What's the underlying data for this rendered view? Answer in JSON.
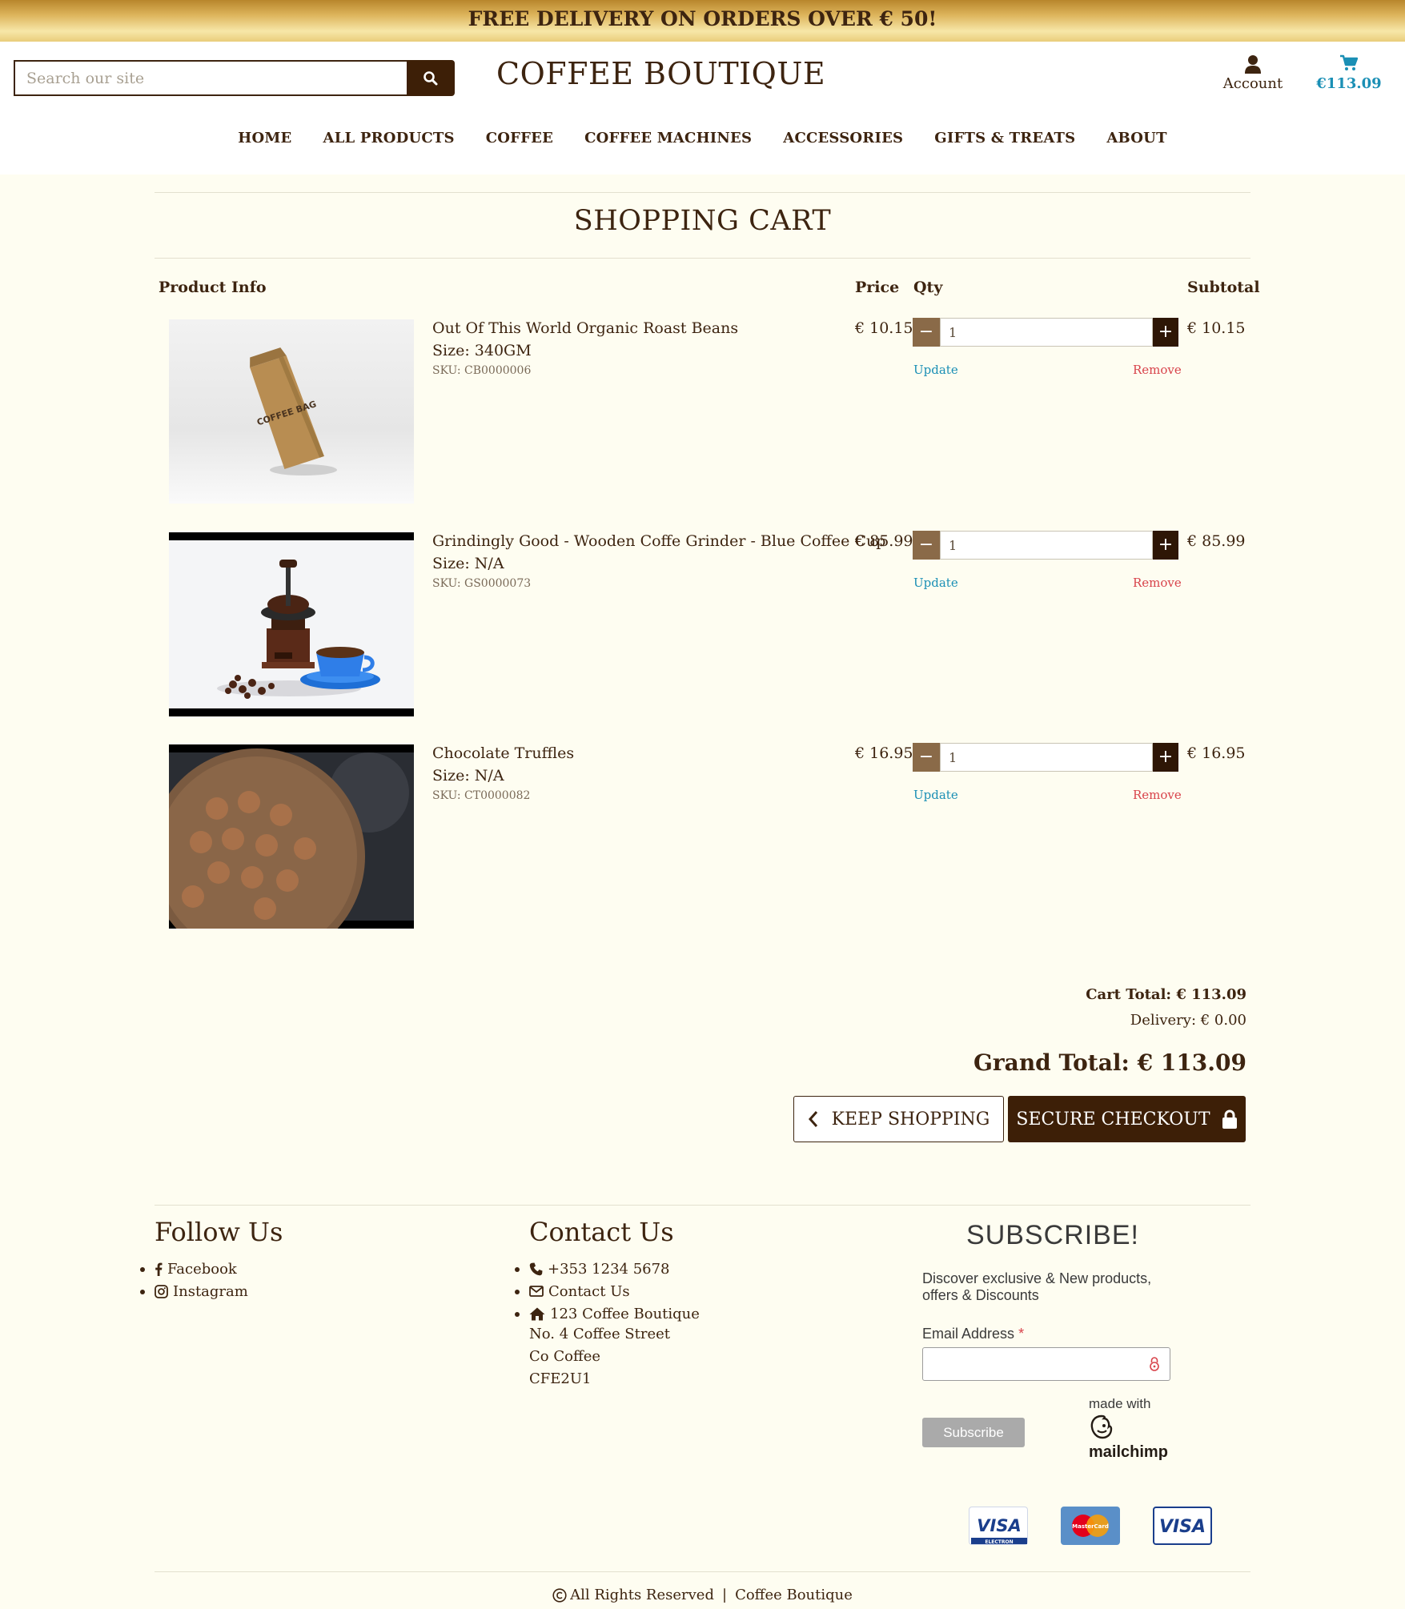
{
  "banner": {
    "text": "FREE DELIVERY ON ORDERS OVER € 50!"
  },
  "header": {
    "search_placeholder": "Search our site",
    "site_title": "COFFEE BOUTIQUE",
    "account_label": "Account",
    "cart_total": "€113.09"
  },
  "nav": [
    "HOME",
    "ALL PRODUCTS",
    "COFFEE",
    "COFFEE MACHINES",
    "ACCESSORIES",
    "GIFTS & TREATS",
    "ABOUT"
  ],
  "page_title": "SHOPPING CART",
  "columns": {
    "product": "Product Info",
    "price": "Price",
    "qty": "Qty",
    "subtotal": "Subtotal"
  },
  "items": [
    {
      "name": "Out Of This World Organic Roast Beans",
      "size": "Size: 340GM",
      "sku": "SKU: CB0000006",
      "price": "€ 10.15",
      "qty": "1",
      "subtotal": "€ 10.15",
      "update": "Update",
      "remove": "Remove",
      "image_label": "COFFEE BAG"
    },
    {
      "name": "Grindingly Good - Wooden Coffe Grinder - Blue Coffee Cup",
      "size": "Size: N/A",
      "sku": "SKU: GS0000073",
      "price": "€ 85.99",
      "qty": "1",
      "subtotal": "€ 85.99",
      "update": "Update",
      "remove": "Remove"
    },
    {
      "name": "Chocolate Truffles",
      "size": "Size: N/A",
      "sku": "SKU: CT0000082",
      "price": "€ 16.95",
      "qty": "1",
      "subtotal": "€ 16.95",
      "update": "Update",
      "remove": "Remove"
    }
  ],
  "totals": {
    "cart_total": "Cart Total: € 113.09",
    "delivery": "Delivery: € 0.00",
    "grand_total": "Grand Total: € 113.09"
  },
  "buttons": {
    "keep_shopping": "KEEP SHOPPING",
    "secure_checkout": "SECURE CHECKOUT"
  },
  "footer": {
    "follow_title": "Follow Us",
    "social": [
      "Facebook",
      "Instagram"
    ],
    "contact_title": "Contact Us",
    "phone": "+353 1234 5678",
    "contact_link": "Contact Us",
    "address": [
      "123 Coffee Boutique",
      "No. 4 Coffee Street",
      "Co Coffee",
      "CFE2U1"
    ],
    "subscribe_title": "SUBSCRIBE!",
    "subscribe_text": "Discover exclusive & New products, offers & Discounts",
    "email_label": "Email Address",
    "required_mark": "*",
    "subscribe_button": "Subscribe",
    "made_with": "made with",
    "mailchimp": "mailchimp",
    "cards": [
      "VISA",
      "MasterCard",
      "VISA"
    ],
    "card_sub": "ELECTRON",
    "copyright": "All Rights Reserved",
    "separator": "|",
    "copyright_name": "Coffee Boutique"
  },
  "colors": {
    "brand_brown": "#3d1f07",
    "link_blue": "#1a8fb5",
    "remove_red": "#d8434b",
    "page_bg": "#fefdf1"
  }
}
